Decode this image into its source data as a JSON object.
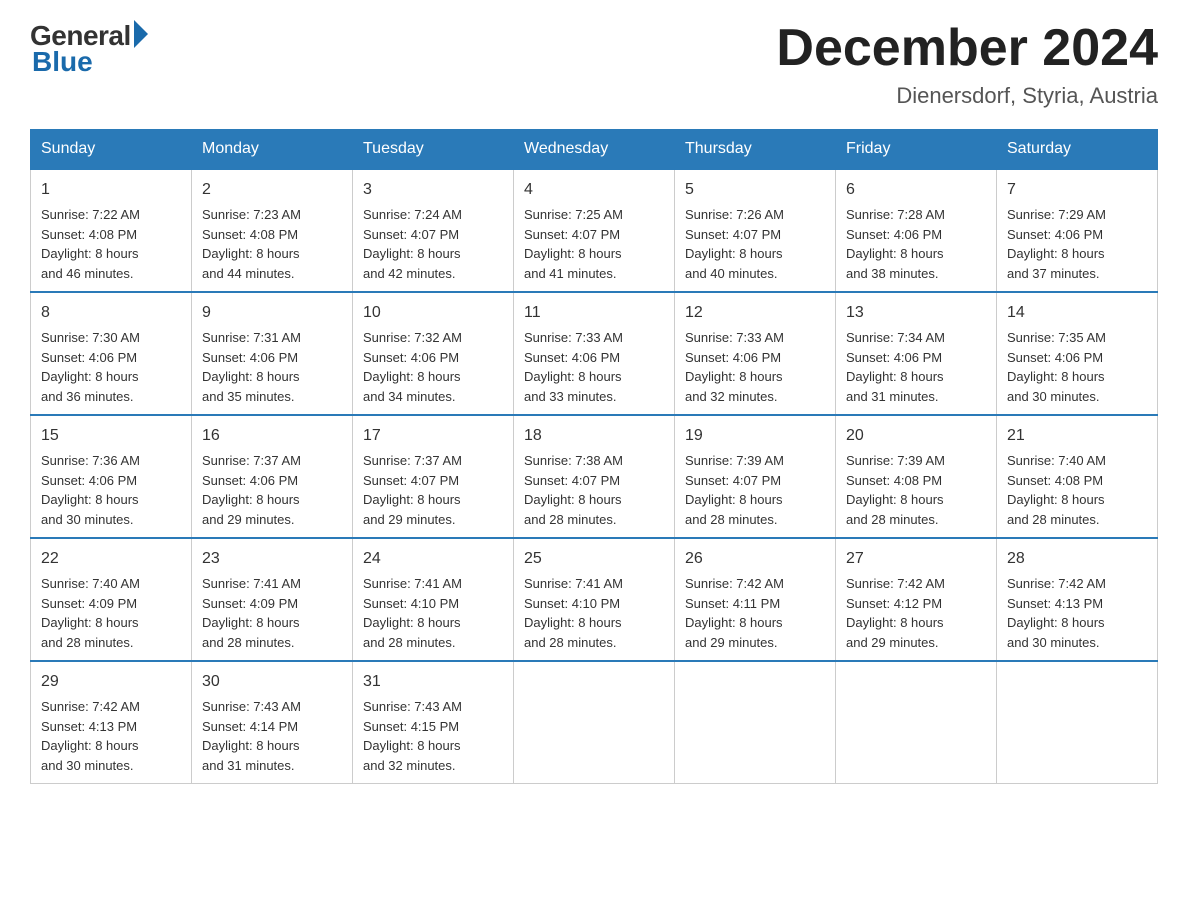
{
  "header": {
    "logo_general": "General",
    "logo_blue": "Blue",
    "title": "December 2024",
    "location": "Dienersdorf, Styria, Austria"
  },
  "days_of_week": [
    "Sunday",
    "Monday",
    "Tuesday",
    "Wednesday",
    "Thursday",
    "Friday",
    "Saturday"
  ],
  "weeks": [
    [
      {
        "day": "1",
        "sunrise": "7:22 AM",
        "sunset": "4:08 PM",
        "daylight": "8 hours and 46 minutes."
      },
      {
        "day": "2",
        "sunrise": "7:23 AM",
        "sunset": "4:08 PM",
        "daylight": "8 hours and 44 minutes."
      },
      {
        "day": "3",
        "sunrise": "7:24 AM",
        "sunset": "4:07 PM",
        "daylight": "8 hours and 42 minutes."
      },
      {
        "day": "4",
        "sunrise": "7:25 AM",
        "sunset": "4:07 PM",
        "daylight": "8 hours and 41 minutes."
      },
      {
        "day": "5",
        "sunrise": "7:26 AM",
        "sunset": "4:07 PM",
        "daylight": "8 hours and 40 minutes."
      },
      {
        "day": "6",
        "sunrise": "7:28 AM",
        "sunset": "4:06 PM",
        "daylight": "8 hours and 38 minutes."
      },
      {
        "day": "7",
        "sunrise": "7:29 AM",
        "sunset": "4:06 PM",
        "daylight": "8 hours and 37 minutes."
      }
    ],
    [
      {
        "day": "8",
        "sunrise": "7:30 AM",
        "sunset": "4:06 PM",
        "daylight": "8 hours and 36 minutes."
      },
      {
        "day": "9",
        "sunrise": "7:31 AM",
        "sunset": "4:06 PM",
        "daylight": "8 hours and 35 minutes."
      },
      {
        "day": "10",
        "sunrise": "7:32 AM",
        "sunset": "4:06 PM",
        "daylight": "8 hours and 34 minutes."
      },
      {
        "day": "11",
        "sunrise": "7:33 AM",
        "sunset": "4:06 PM",
        "daylight": "8 hours and 33 minutes."
      },
      {
        "day": "12",
        "sunrise": "7:33 AM",
        "sunset": "4:06 PM",
        "daylight": "8 hours and 32 minutes."
      },
      {
        "day": "13",
        "sunrise": "7:34 AM",
        "sunset": "4:06 PM",
        "daylight": "8 hours and 31 minutes."
      },
      {
        "day": "14",
        "sunrise": "7:35 AM",
        "sunset": "4:06 PM",
        "daylight": "8 hours and 30 minutes."
      }
    ],
    [
      {
        "day": "15",
        "sunrise": "7:36 AM",
        "sunset": "4:06 PM",
        "daylight": "8 hours and 30 minutes."
      },
      {
        "day": "16",
        "sunrise": "7:37 AM",
        "sunset": "4:06 PM",
        "daylight": "8 hours and 29 minutes."
      },
      {
        "day": "17",
        "sunrise": "7:37 AM",
        "sunset": "4:07 PM",
        "daylight": "8 hours and 29 minutes."
      },
      {
        "day": "18",
        "sunrise": "7:38 AM",
        "sunset": "4:07 PM",
        "daylight": "8 hours and 28 minutes."
      },
      {
        "day": "19",
        "sunrise": "7:39 AM",
        "sunset": "4:07 PM",
        "daylight": "8 hours and 28 minutes."
      },
      {
        "day": "20",
        "sunrise": "7:39 AM",
        "sunset": "4:08 PM",
        "daylight": "8 hours and 28 minutes."
      },
      {
        "day": "21",
        "sunrise": "7:40 AM",
        "sunset": "4:08 PM",
        "daylight": "8 hours and 28 minutes."
      }
    ],
    [
      {
        "day": "22",
        "sunrise": "7:40 AM",
        "sunset": "4:09 PM",
        "daylight": "8 hours and 28 minutes."
      },
      {
        "day": "23",
        "sunrise": "7:41 AM",
        "sunset": "4:09 PM",
        "daylight": "8 hours and 28 minutes."
      },
      {
        "day": "24",
        "sunrise": "7:41 AM",
        "sunset": "4:10 PM",
        "daylight": "8 hours and 28 minutes."
      },
      {
        "day": "25",
        "sunrise": "7:41 AM",
        "sunset": "4:10 PM",
        "daylight": "8 hours and 28 minutes."
      },
      {
        "day": "26",
        "sunrise": "7:42 AM",
        "sunset": "4:11 PM",
        "daylight": "8 hours and 29 minutes."
      },
      {
        "day": "27",
        "sunrise": "7:42 AM",
        "sunset": "4:12 PM",
        "daylight": "8 hours and 29 minutes."
      },
      {
        "day": "28",
        "sunrise": "7:42 AM",
        "sunset": "4:13 PM",
        "daylight": "8 hours and 30 minutes."
      }
    ],
    [
      {
        "day": "29",
        "sunrise": "7:42 AM",
        "sunset": "4:13 PM",
        "daylight": "8 hours and 30 minutes."
      },
      {
        "day": "30",
        "sunrise": "7:43 AM",
        "sunset": "4:14 PM",
        "daylight": "8 hours and 31 minutes."
      },
      {
        "day": "31",
        "sunrise": "7:43 AM",
        "sunset": "4:15 PM",
        "daylight": "8 hours and 32 minutes."
      },
      null,
      null,
      null,
      null
    ]
  ],
  "labels": {
    "sunrise": "Sunrise:",
    "sunset": "Sunset:",
    "daylight": "Daylight:"
  }
}
